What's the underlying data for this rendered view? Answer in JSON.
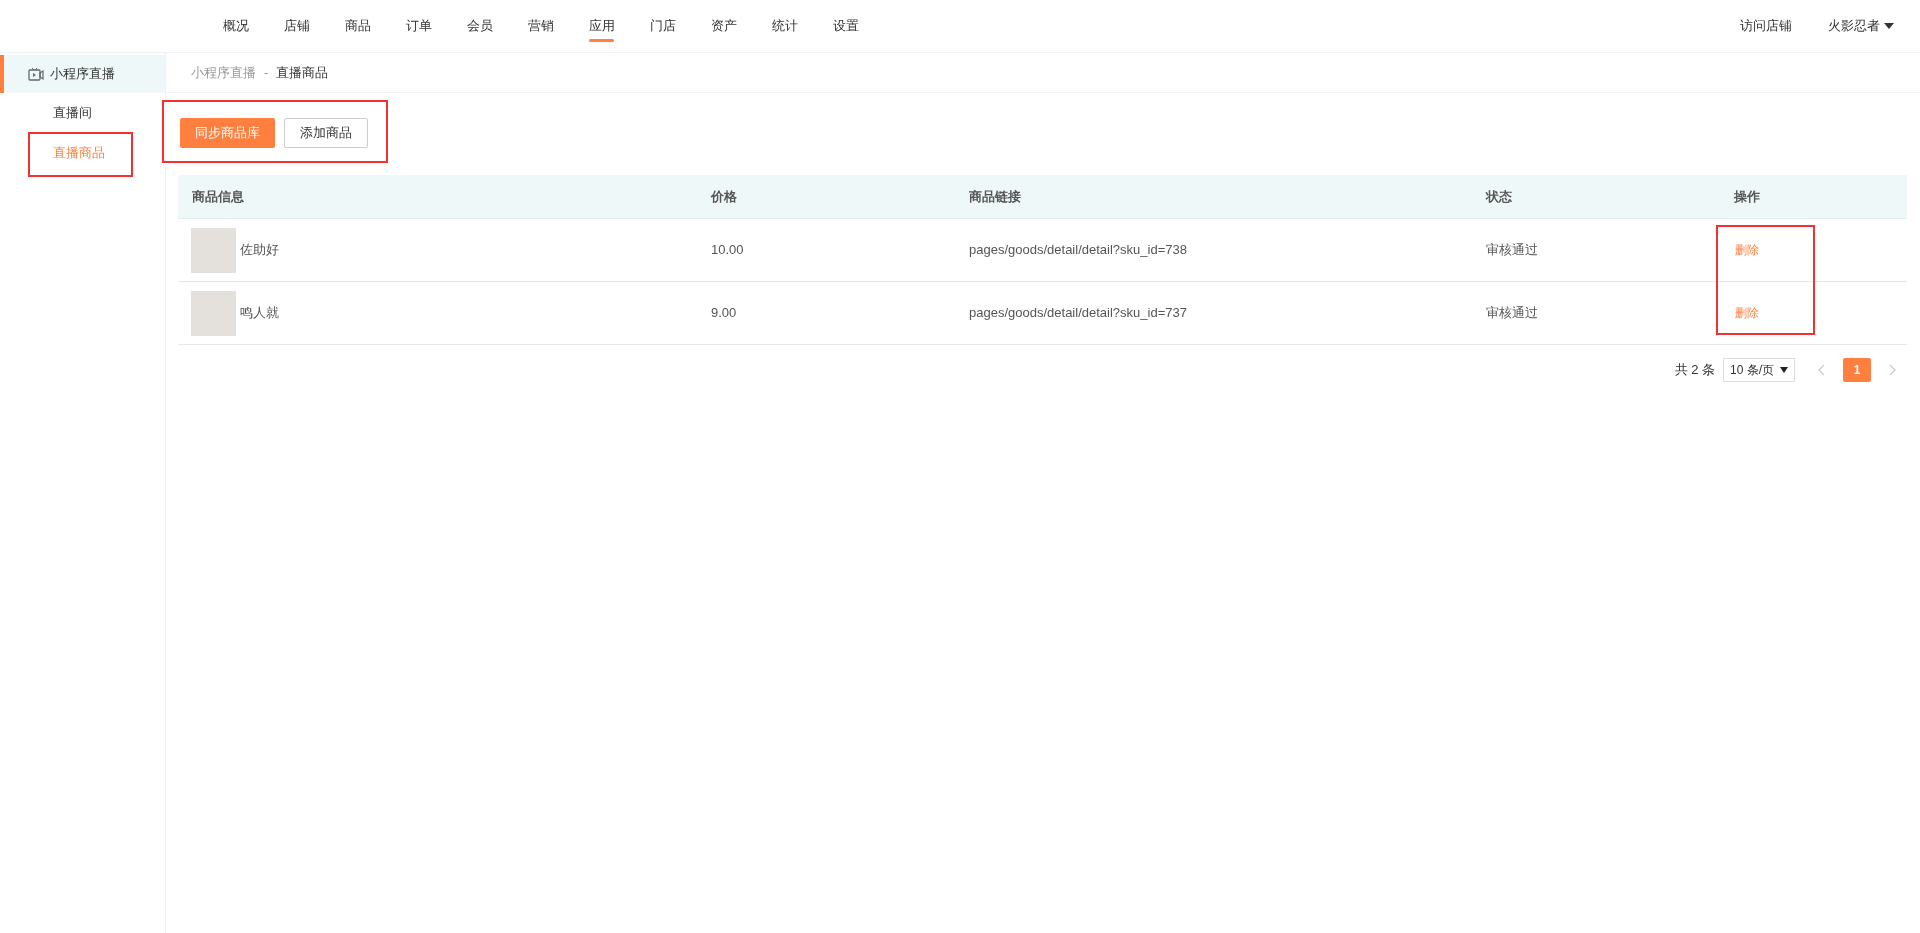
{
  "top_nav": {
    "items": [
      {
        "label": "概况",
        "selected": false
      },
      {
        "label": "店铺",
        "selected": false
      },
      {
        "label": "商品",
        "selected": false
      },
      {
        "label": "订单",
        "selected": false
      },
      {
        "label": "会员",
        "selected": false
      },
      {
        "label": "营销",
        "selected": false
      },
      {
        "label": "应用",
        "selected": true
      },
      {
        "label": "门店",
        "selected": false
      },
      {
        "label": "资产",
        "selected": false
      },
      {
        "label": "统计",
        "selected": false
      },
      {
        "label": "设置",
        "selected": false
      }
    ],
    "visit_store": "访问店铺",
    "user": "火影忍者"
  },
  "sidebar": {
    "title": "小程序直播",
    "items": [
      {
        "label": "直播间",
        "selected": false
      },
      {
        "label": "直播商品",
        "selected": true
      }
    ]
  },
  "breadcrumb": [
    "小程序直播",
    "直播商品"
  ],
  "breadcrumb_separator": "-",
  "buttons": [
    {
      "label": "同步商品库",
      "kind": "primary"
    },
    {
      "label": "添加商品",
      "kind": "default"
    }
  ],
  "table": {
    "columns": [
      "商品信息",
      "价格",
      "商品链接",
      "状态",
      "操作"
    ],
    "rows": [
      {
        "name": "佐助好",
        "price": "10.00",
        "link": "pages/goods/detail/detail?sku_id=738",
        "status": "审核通过",
        "action": "删除"
      },
      {
        "name": "鸣人就",
        "price": "9.00",
        "link": "pages/goods/detail/detail?sku_id=737",
        "status": "审核通过",
        "action": "删除"
      }
    ]
  },
  "pagination": {
    "total": "共 2 条",
    "page_size": "10 条/页",
    "pages": [
      {
        "label": "1",
        "selected": true
      }
    ]
  }
}
